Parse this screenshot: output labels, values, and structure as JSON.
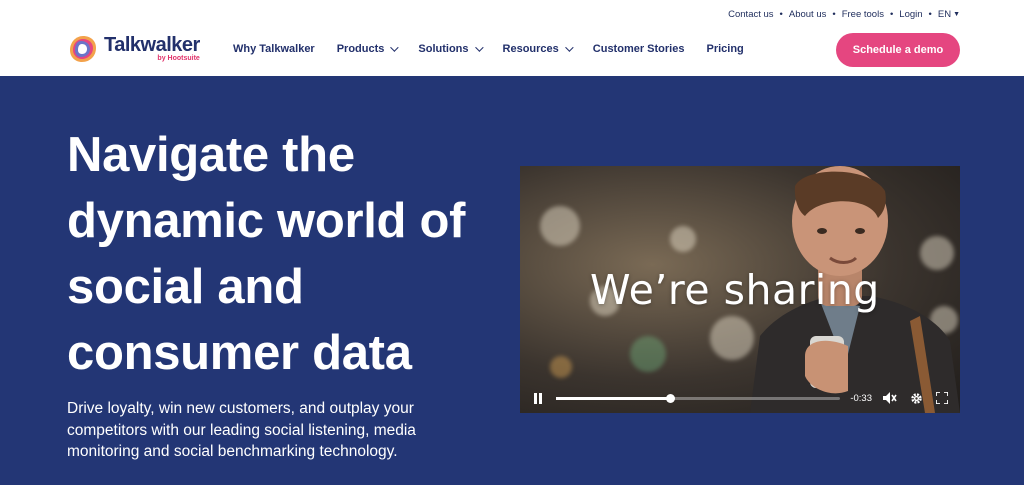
{
  "utility": {
    "contact": "Contact us",
    "about": "About us",
    "free_tools": "Free tools",
    "login": "Login",
    "language": "EN",
    "separator": "•"
  },
  "brand": {
    "name": "Talkwalker",
    "sub": "by Hootsuite",
    "primary_color": "#22306b",
    "accent_color": "#e54680"
  },
  "nav": {
    "items": [
      {
        "label": "Why Talkwalker",
        "dropdown": false
      },
      {
        "label": "Products",
        "dropdown": true
      },
      {
        "label": "Solutions",
        "dropdown": true
      },
      {
        "label": "Resources",
        "dropdown": true
      },
      {
        "label": "Customer Stories",
        "dropdown": false
      },
      {
        "label": "Pricing",
        "dropdown": false
      }
    ],
    "cta": "Schedule a demo"
  },
  "hero": {
    "headline": "Navigate the dynamic world of social and consumer data",
    "subcopy": "Drive loyalty, win new customers, and outplay your competitors with our leading social listening, media monitoring and social benchmarking technology.",
    "background": "#233675"
  },
  "video": {
    "caption": "We’re sharing",
    "time_remaining": "-0:33",
    "progress": 0.4,
    "controls": [
      "pause-icon",
      "mute-icon",
      "gear-icon",
      "fullscreen-icon"
    ]
  }
}
